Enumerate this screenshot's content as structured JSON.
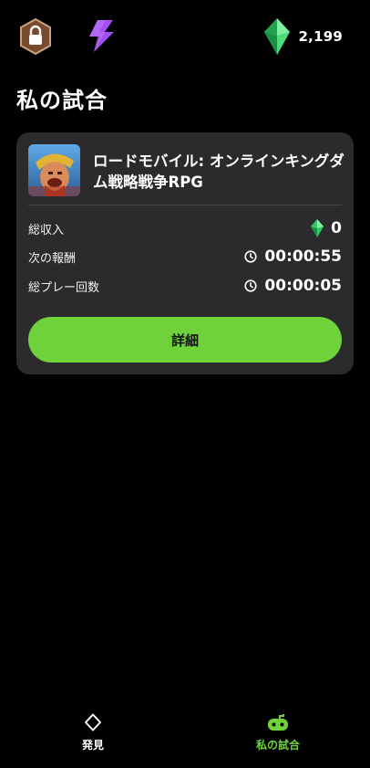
{
  "header": {
    "gem_count": "2,199",
    "lock_icon": "lock-badge-icon",
    "bolt_icon": "lightning-bolt-icon",
    "gem_icon": "green-gem-icon"
  },
  "page": {
    "title": "私の試合"
  },
  "match_card": {
    "game_title": "ロードモバイル: オンラインキングダム戦略戦争RPG",
    "rows": [
      {
        "label": "総収入",
        "value": "0",
        "icon": "green-gem-icon"
      },
      {
        "label": "次の報酬",
        "value": "00:00:55",
        "icon": "clock-icon"
      },
      {
        "label": "総プレー回数",
        "value": "00:00:05",
        "icon": "clock-icon"
      }
    ],
    "details_button": "詳細"
  },
  "bottom_nav": {
    "items": [
      {
        "label": "発見",
        "icon": "diamond-outline-icon",
        "active": false
      },
      {
        "label": "私の試合",
        "icon": "gamepad-icon",
        "active": true
      }
    ]
  },
  "colors": {
    "accent": "#6fd23a",
    "card_bg": "#2b2b2e",
    "background": "#000000",
    "lock_badge": "#8b5a3c",
    "bolt": "#a24ef0"
  }
}
